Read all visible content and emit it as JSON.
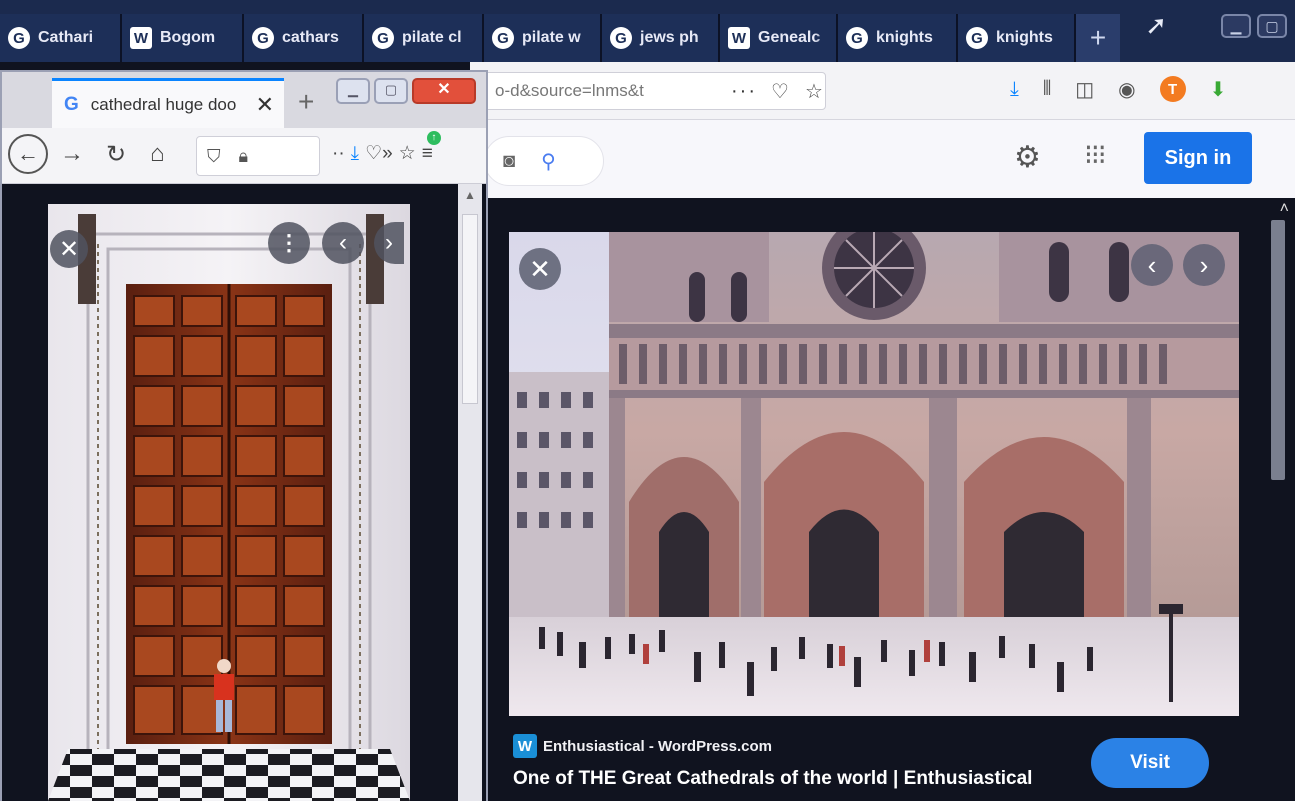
{
  "back_window": {
    "tabs": [
      {
        "icon": "G",
        "label": "Cathari"
      },
      {
        "icon": "W",
        "label": "Bogom"
      },
      {
        "icon": "G",
        "label": "cathars"
      },
      {
        "icon": "G",
        "label": "pilate cl"
      },
      {
        "icon": "G",
        "label": "pilate w"
      },
      {
        "icon": "G",
        "label": "jews ph"
      },
      {
        "icon": "W",
        "label": "Genealc"
      },
      {
        "icon": "G",
        "label": "knights"
      },
      {
        "icon": "G",
        "label": "knights"
      }
    ],
    "new_tab": "+",
    "url_fragment": "o-d&source=lnms&t",
    "url_more": "···",
    "signin_label": "Sign in",
    "result": {
      "source_name": "Enthusiastical - WordPress.com",
      "caption": "One of THE Great Cathedrals of the world | Enthusiastical",
      "visit_label": "Visit"
    }
  },
  "front_window": {
    "tab_icon": "G",
    "tab_title": "cathedral huge doo",
    "tab_close": "✕",
    "new_tab": "+"
  },
  "colors": {
    "accent_blue": "#1a73e8",
    "tab_strip": "#1b2a4e",
    "close_red": "#e2503b",
    "panel_dark": "#10131f"
  }
}
